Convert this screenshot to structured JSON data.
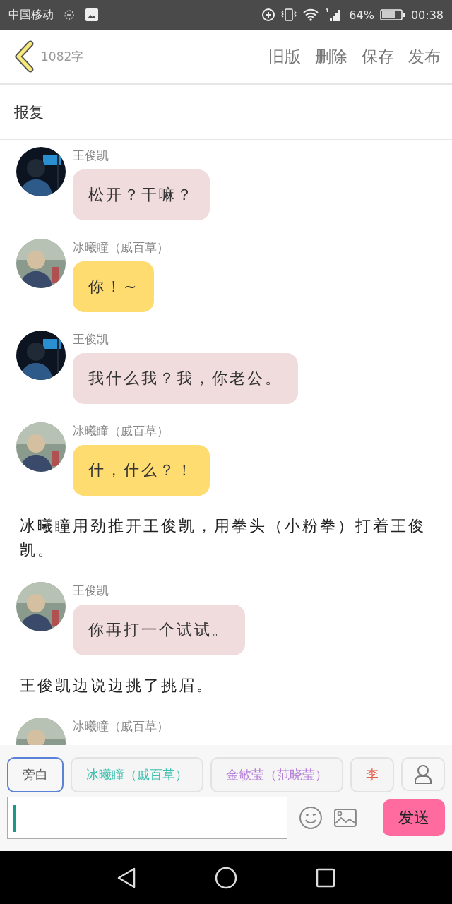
{
  "status_bar": {
    "carrier": "中国移动",
    "battery": "64%",
    "time": "00:38"
  },
  "header": {
    "word_count": "1082字",
    "actions": [
      "旧版",
      "删除",
      "保存",
      "发布"
    ]
  },
  "title": "报复",
  "messages": [
    {
      "kind": "dialogue",
      "speaker": "王俊凯",
      "text": "松开？干嘛？",
      "color": "#f0dcdd"
    },
    {
      "kind": "dialogue",
      "speaker": "冰曦瞳（戚百草）",
      "text": "你！~",
      "color": "#ffdc70"
    },
    {
      "kind": "dialogue",
      "speaker": "王俊凯",
      "text": "我什么我？我，你老公。",
      "color": "#f0dcdd"
    },
    {
      "kind": "dialogue",
      "speaker": "冰曦瞳（戚百草）",
      "text": "什，什么？！",
      "color": "#ffdc70"
    },
    {
      "kind": "narration",
      "text": "冰曦瞳用劲推开王俊凯，用拳头（小粉拳）打着王俊凯。"
    },
    {
      "kind": "dialogue",
      "speaker": "王俊凯",
      "text": "你再打一个试试。",
      "color": "#f0dcdd"
    },
    {
      "kind": "narration",
      "text": "王俊凯边说边挑了挑眉。"
    },
    {
      "kind": "dialogue",
      "speaker": "冰曦瞳（戚百草）"
    }
  ],
  "characters": [
    {
      "label": "旁白",
      "selected": true,
      "color": "#555555"
    },
    {
      "label": "冰曦瞳（戚百草）",
      "selected": false,
      "color": "#3cbfae"
    },
    {
      "label": "金敏莹（范晓莹）",
      "selected": false,
      "color": "#b57ed8"
    },
    {
      "label": "李",
      "selected": false,
      "color": "#e8604c"
    }
  ],
  "send_button": "发送"
}
